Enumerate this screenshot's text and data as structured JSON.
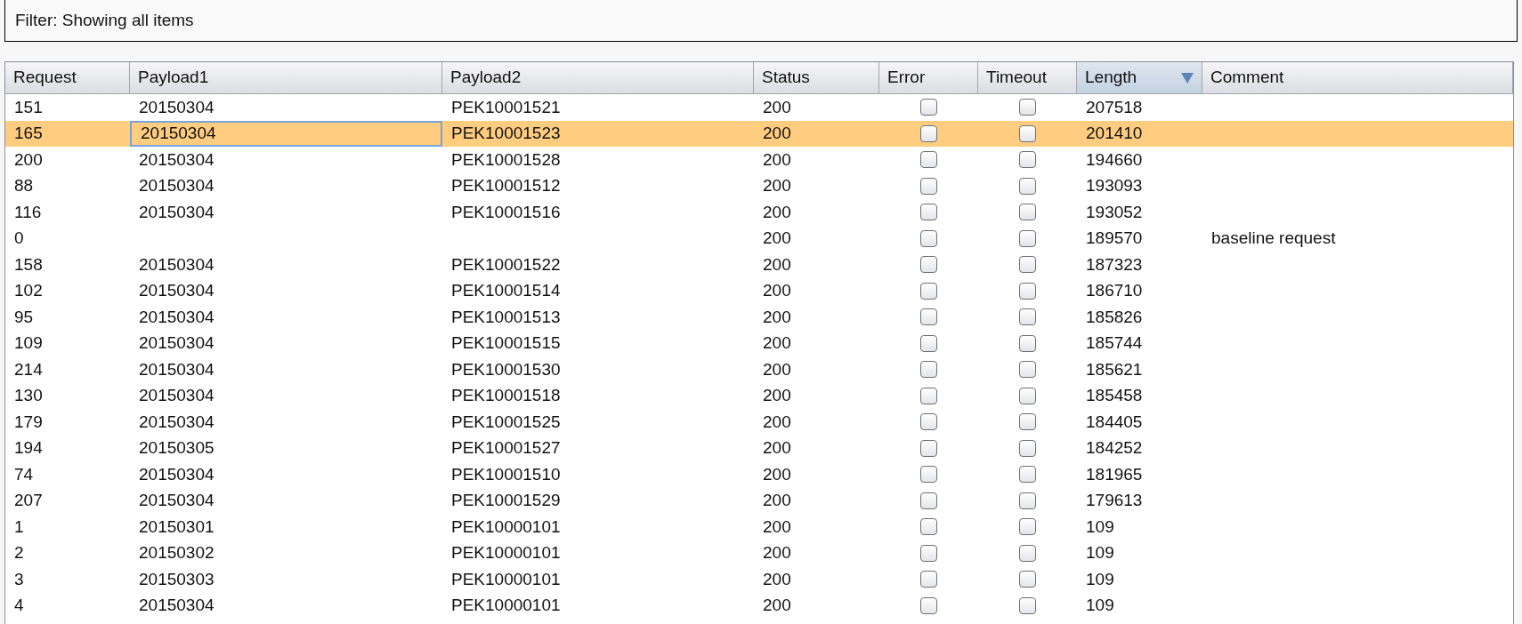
{
  "filter_bar": {
    "text": "Filter: Showing all items"
  },
  "table": {
    "columns": [
      {
        "kind": "text",
        "label": "Request",
        "sorted": false
      },
      {
        "kind": "text",
        "label": "Payload1",
        "sorted": false
      },
      {
        "kind": "text",
        "label": "Payload2",
        "sorted": false
      },
      {
        "kind": "text",
        "label": "Status",
        "sorted": false
      },
      {
        "kind": "checkbox",
        "label": "Error",
        "sorted": false
      },
      {
        "kind": "checkbox",
        "label": "Timeout",
        "sorted": false
      },
      {
        "kind": "text",
        "label": "Length",
        "sorted": true
      },
      {
        "kind": "text",
        "label": "Comment",
        "sorted": false
      }
    ],
    "rows": [
      {
        "request": "151",
        "payload1": "20150304",
        "payload2": "PEK10001521",
        "status": "200",
        "error": false,
        "timeout": false,
        "length": "207518",
        "selected": false,
        "focused": false
      },
      {
        "request": "165",
        "payload1": "20150304",
        "payload2": "PEK10001523",
        "status": "200",
        "error": false,
        "timeout": false,
        "length": "201410",
        "selected": true,
        "focused": true
      },
      {
        "request": "200",
        "payload1": "20150304",
        "payload2": "PEK10001528",
        "status": "200",
        "error": false,
        "timeout": false,
        "length": "194660",
        "selected": false,
        "focused": false
      },
      {
        "request": "88",
        "payload1": "20150304",
        "payload2": "PEK10001512",
        "status": "200",
        "error": false,
        "timeout": false,
        "length": "193093",
        "selected": false,
        "focused": false
      },
      {
        "request": "116",
        "payload1": "20150304",
        "payload2": "PEK10001516",
        "status": "200",
        "error": false,
        "timeout": false,
        "length": "193052",
        "selected": false,
        "focused": false
      },
      {
        "request": "0",
        "status": "200",
        "error": false,
        "timeout": false,
        "length": "189570",
        "comment": "baseline request",
        "selected": false,
        "focused": false
      },
      {
        "request": "158",
        "payload1": "20150304",
        "payload2": "PEK10001522",
        "status": "200",
        "error": false,
        "timeout": false,
        "length": "187323",
        "selected": false,
        "focused": false
      },
      {
        "request": "102",
        "payload1": "20150304",
        "payload2": "PEK10001514",
        "status": "200",
        "error": false,
        "timeout": false,
        "length": "186710",
        "selected": false,
        "focused": false
      },
      {
        "request": "95",
        "payload1": "20150304",
        "payload2": "PEK10001513",
        "status": "200",
        "error": false,
        "timeout": false,
        "length": "185826",
        "selected": false,
        "focused": false
      },
      {
        "request": "109",
        "payload1": "20150304",
        "payload2": "PEK10001515",
        "status": "200",
        "error": false,
        "timeout": false,
        "length": "185744",
        "selected": false,
        "focused": false
      },
      {
        "request": "214",
        "payload1": "20150304",
        "payload2": "PEK10001530",
        "status": "200",
        "error": false,
        "timeout": false,
        "length": "185621",
        "selected": false,
        "focused": false
      },
      {
        "request": "130",
        "payload1": "20150304",
        "payload2": "PEK10001518",
        "status": "200",
        "error": false,
        "timeout": false,
        "length": "185458",
        "selected": false,
        "focused": false
      },
      {
        "request": "179",
        "payload1": "20150304",
        "payload2": "PEK10001525",
        "status": "200",
        "error": false,
        "timeout": false,
        "length": "184405",
        "selected": false,
        "focused": false
      },
      {
        "request": "194",
        "payload1": "20150305",
        "payload2": "PEK10001527",
        "status": "200",
        "error": false,
        "timeout": false,
        "length": "184252",
        "selected": false,
        "focused": false
      },
      {
        "request": "74",
        "payload1": "20150304",
        "payload2": "PEK10001510",
        "status": "200",
        "error": false,
        "timeout": false,
        "length": "181965",
        "selected": false,
        "focused": false
      },
      {
        "request": "207",
        "payload1": "20150304",
        "payload2": "PEK10001529",
        "status": "200",
        "error": false,
        "timeout": false,
        "length": "179613",
        "selected": false,
        "focused": false
      },
      {
        "request": "1",
        "payload1": "20150301",
        "payload2": "PEK10000101",
        "status": "200",
        "error": false,
        "timeout": false,
        "length": "109",
        "selected": false,
        "focused": false
      },
      {
        "request": "2",
        "payload1": "20150302",
        "payload2": "PEK10000101",
        "status": "200",
        "error": false,
        "timeout": false,
        "length": "109",
        "selected": false,
        "focused": false
      },
      {
        "request": "3",
        "payload1": "20150303",
        "payload2": "PEK10000101",
        "status": "200",
        "error": false,
        "timeout": false,
        "length": "109",
        "selected": false,
        "focused": false
      },
      {
        "request": "4",
        "payload1": "20150304",
        "payload2": "PEK10000101",
        "status": "200",
        "error": false,
        "timeout": false,
        "length": "109",
        "selected": false,
        "focused": false
      }
    ]
  }
}
